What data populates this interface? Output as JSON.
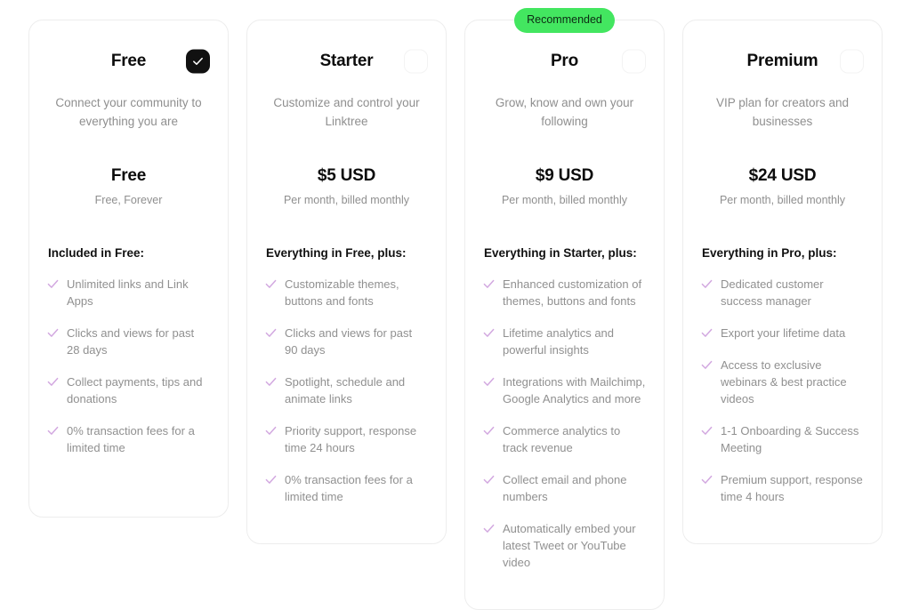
{
  "colors": {
    "badge_background": "#43e660",
    "badge_text": "#0d2b14",
    "checkmark": "#d2a8e0",
    "selected_box": "#111111",
    "card_border": "#ededed",
    "heading_text": "#0c0c0c",
    "muted_text": "#8f8f8f",
    "page_background": "#ffffff"
  },
  "plans": [
    {
      "name": "Free",
      "badge": null,
      "selected": true,
      "selector_icon": "check-icon",
      "description": "Connect your community to everything you are",
      "price": "Free",
      "price_note": "Free, Forever",
      "features_title": "Included in Free:",
      "features": [
        "Unlimited links and Link Apps",
        "Clicks and views for past 28 days",
        "Collect payments, tips and donations",
        "0% transaction fees for a limited time"
      ]
    },
    {
      "name": "Starter",
      "badge": null,
      "selected": false,
      "selector_icon": "empty-checkbox-icon",
      "description": "Customize and control your Linktree",
      "price": "$5 USD",
      "price_note": "Per month, billed monthly",
      "features_title": "Everything in Free, plus:",
      "features": [
        "Customizable themes, buttons and fonts",
        "Clicks and views for past 90 days",
        "Spotlight, schedule and animate links",
        "Priority support, response time 24 hours",
        "0% transaction fees for a limited time"
      ]
    },
    {
      "name": "Pro",
      "badge": "Recommended",
      "selected": false,
      "selector_icon": "empty-checkbox-icon",
      "description": "Grow, know and own your following",
      "price": "$9 USD",
      "price_note": "Per month, billed monthly",
      "features_title": "Everything in Starter, plus:",
      "features": [
        "Enhanced customization of themes, buttons and fonts",
        "Lifetime analytics and powerful insights",
        "Integrations with Mailchimp, Google Analytics and more",
        "Commerce analytics to track revenue",
        "Collect email and phone numbers",
        "Automatically embed your latest Tweet or YouTube video"
      ]
    },
    {
      "name": "Premium",
      "badge": null,
      "selected": false,
      "selector_icon": "empty-checkbox-icon",
      "description": "VIP plan for creators and businesses",
      "price": "$24 USD",
      "price_note": "Per month, billed monthly",
      "features_title": "Everything in Pro, plus:",
      "features": [
        "Dedicated customer success manager",
        "Export your lifetime data",
        "Access to exclusive webinars & best practice videos",
        "1-1 Onboarding & Success Meeting",
        "Premium support, response time 4 hours"
      ]
    }
  ]
}
